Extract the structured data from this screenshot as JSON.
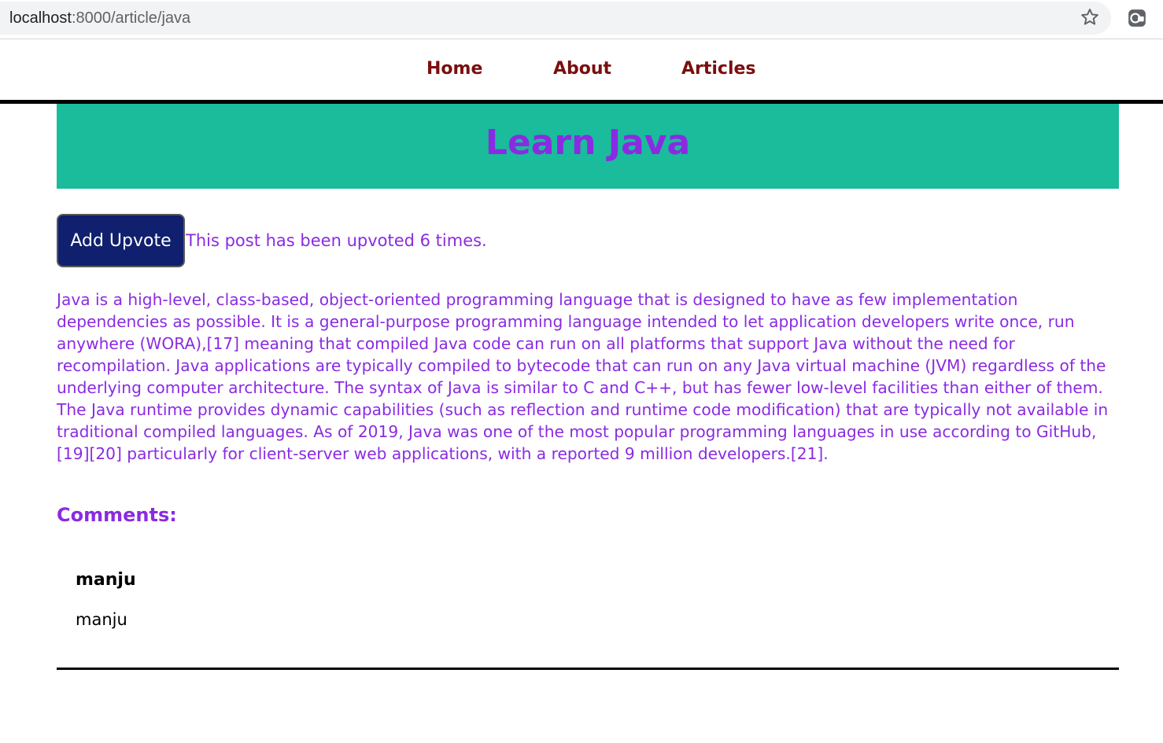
{
  "browser": {
    "url_host": "localhost",
    "url_path": ":8000/article/java"
  },
  "nav": {
    "home": "Home",
    "about": "About",
    "articles": "Articles"
  },
  "article": {
    "title": "Learn Java",
    "upvote_button": "Add Upvote",
    "upvote_status": "This post has been upvoted 6 times.",
    "body": "Java is a high-level, class-based, object-oriented programming language that is designed to have as few implementation dependencies as possible. It is a general-purpose programming language intended to let application developers write once, run anywhere (WORA),[17] meaning that compiled Java code can run on all platforms that support Java without the need for recompilation. Java applications are typically compiled to bytecode that can run on any Java virtual machine (JVM) regardless of the underlying computer architecture. The syntax of Java is similar to C and C++, but has fewer low-level facilities than either of them. The Java runtime provides dynamic capabilities (such as reflection and runtime code modification) that are typically not available in traditional compiled languages. As of 2019, Java was one of the most popular programming languages in use according to GitHub,[19][20] particularly for client-server web applications, with a reported 9 million developers.[21]."
  },
  "comments": {
    "heading": "Comments:",
    "items": [
      {
        "author": "manju",
        "text": "manju"
      }
    ]
  },
  "colors": {
    "banner": "#1abc9c",
    "accent_purple": "#8a2be2",
    "nav_link": "#7a0e0e",
    "button_bg": "#10206e"
  },
  "icons": {
    "bookmark": "star-icon",
    "extension": "extension-icon"
  }
}
